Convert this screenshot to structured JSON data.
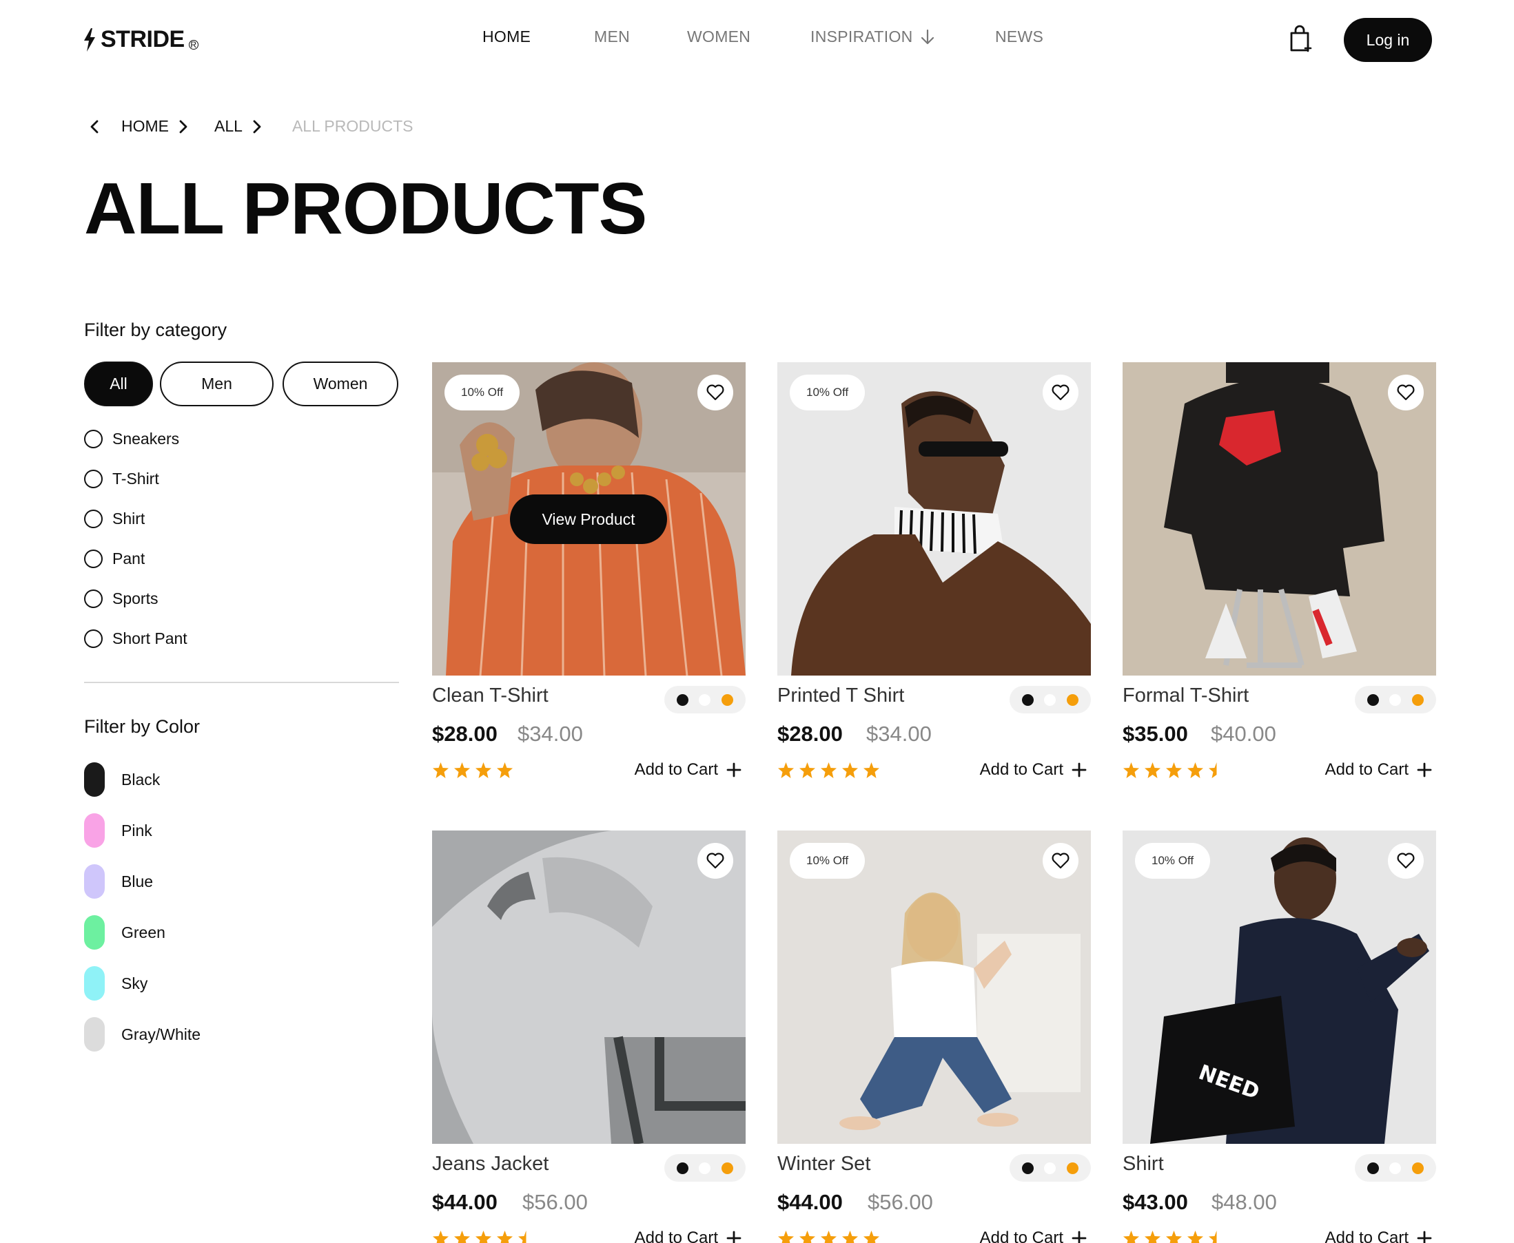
{
  "brand": {
    "name": "STRIDE",
    "reg_mark": "R"
  },
  "nav": {
    "items": [
      {
        "label": "HOME",
        "active": true
      },
      {
        "label": "MEN",
        "active": false
      },
      {
        "label": "WOMEN",
        "active": false
      },
      {
        "label": "INSPIRATION",
        "active": false
      },
      {
        "label": "NEWS",
        "active": false
      }
    ]
  },
  "header": {
    "login_label": "Log in"
  },
  "breadcrumb": {
    "items": [
      "HOME",
      "ALL",
      "ALL PRODUCTS"
    ]
  },
  "page_title": "ALL PRODUCTS",
  "sidebar": {
    "category_heading": "Filter by category",
    "pills": [
      "All",
      "Men",
      "Women"
    ],
    "categories": [
      "Sneakers",
      "T-Shirt",
      "Shirt",
      "Pant",
      "Sports",
      "Short Pant"
    ],
    "color_heading": "Filter by Color",
    "colors": [
      {
        "label": "Black",
        "hex": "#1a1a1a"
      },
      {
        "label": "Pink",
        "hex": "#f9a3e6"
      },
      {
        "label": "Blue",
        "hex": "#cfc6fb"
      },
      {
        "label": "Green",
        "hex": "#6df0a0"
      },
      {
        "label": "Sky",
        "hex": "#8ff2f7"
      },
      {
        "label": "Gray/White",
        "hex": "#dcdcdc"
      }
    ]
  },
  "products": [
    {
      "name": "Clean T-Shirt",
      "price": "$28.00",
      "old_price": "$34.00",
      "badge": "10% Off",
      "rating": 4,
      "hover_label": "View Product",
      "add_label": "Add to Cart"
    },
    {
      "name": "Printed T Shirt",
      "price": "$28.00",
      "old_price": "$34.00",
      "badge": "10% Off",
      "rating": 5,
      "add_label": "Add to Cart"
    },
    {
      "name": "Formal T-Shirt",
      "price": "$35.00",
      "old_price": "$40.00",
      "badge": "",
      "rating": 4.5,
      "add_label": "Add to Cart"
    },
    {
      "name": "Jeans Jacket",
      "price": "$44.00",
      "old_price": "$56.00",
      "badge": "",
      "rating": 4.5,
      "add_label": "Add to Cart"
    },
    {
      "name": "Winter Set",
      "price": "$44.00",
      "old_price": "$56.00",
      "badge": "10% Off",
      "rating": 5,
      "add_label": "Add to Cart"
    },
    {
      "name": "Shirt",
      "price": "$43.00",
      "old_price": "$48.00",
      "badge": "10% Off",
      "rating": 4.5,
      "add_label": "Add to Cart"
    }
  ],
  "colors": {
    "accent": "#0b0b0b",
    "star": "#f59e0b",
    "dot_black": "#111111",
    "dot_white": "#ffffff",
    "dot_orange": "#f59e0b"
  }
}
